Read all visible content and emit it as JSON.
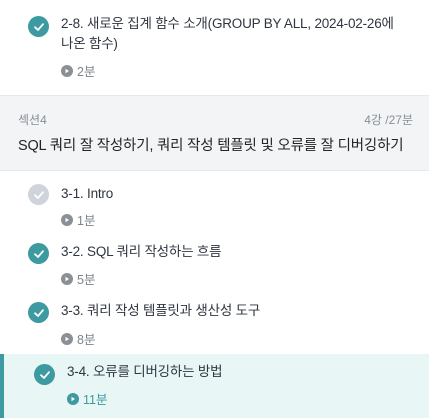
{
  "colors": {
    "accent": "#3c9aa0",
    "completed_check": "#3c9aa0",
    "pending_check": "#ced4da",
    "active_bg": "#e8f6f5"
  },
  "top_lesson": {
    "title_line1": "2-8. 새로운 집계 함수 소개(GROUP BY ALL, 2024-02-26에",
    "title_line2": "나온 함수)",
    "duration": "2분",
    "completed": true
  },
  "section": {
    "label": "섹션4",
    "count": "4강 /27분",
    "title": "SQL 쿼리 잘 작성하기, 쿼리 작성 템플릿 및 오류를 잘 디버깅하기"
  },
  "lessons": [
    {
      "title": "3-1. Intro",
      "duration": "1분",
      "completed": false,
      "active": false
    },
    {
      "title": "3-2. SQL 쿼리 작성하는 흐름",
      "duration": "5분",
      "completed": true,
      "active": false
    },
    {
      "title": "3-3. 쿼리 작성 템플릿과 생산성 도구",
      "duration": "8분",
      "completed": true,
      "active": false
    },
    {
      "title": "3-4. 오류를 디버깅하는 방법",
      "duration": "11분",
      "completed": true,
      "active": true
    }
  ],
  "icons": {
    "check": "check-icon",
    "play": "play-icon"
  }
}
